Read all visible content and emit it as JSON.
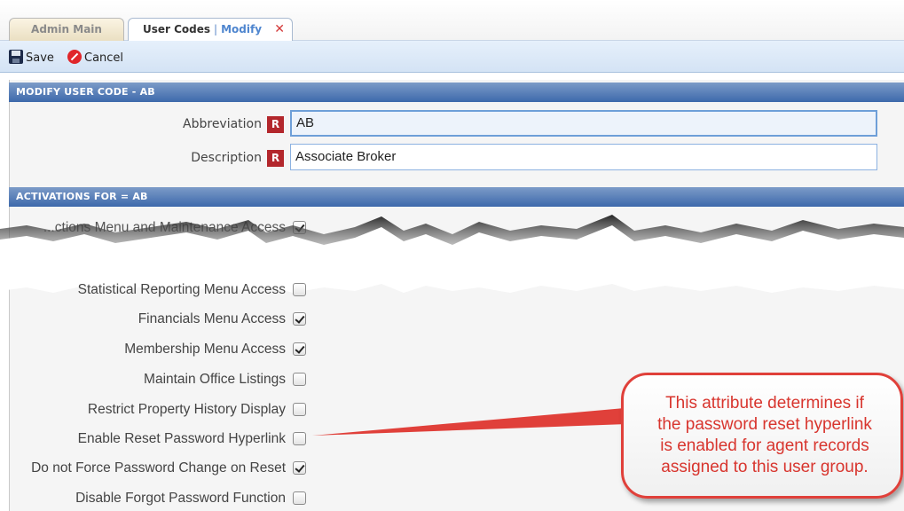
{
  "tabs": [
    {
      "label": "Admin Main"
    },
    {
      "label": "User Codes",
      "sub": "Modify"
    }
  ],
  "toolbar": {
    "save_label": "Save",
    "cancel_label": "Cancel"
  },
  "modify_section": {
    "title": "MODIFY USER CODE - AB",
    "fields": [
      {
        "label": "Abbreviation",
        "required_badge": "R",
        "value": "AB"
      },
      {
        "label": "Description",
        "required_badge": "R",
        "value": "Associate Broker"
      }
    ]
  },
  "activations_section": {
    "title": "ACTIVATIONS FOR = AB",
    "partial_rows": [
      {
        "label": "...ctions Menu and Maintenance Access",
        "checked": true
      },
      {
        "label": "Statistical Reporting Menu Access",
        "checked": false
      }
    ],
    "rows": [
      {
        "label": "Financials Menu Access",
        "checked": true
      },
      {
        "label": "Membership Menu Access",
        "checked": true
      },
      {
        "label": "Maintain Office Listings",
        "checked": false
      },
      {
        "label": "Restrict Property History Display",
        "checked": false
      },
      {
        "label": "Enable Reset Password Hyperlink",
        "checked": false
      },
      {
        "label": "Do not Force Password Change on Reset",
        "checked": true
      },
      {
        "label": "Disable Forgot Password Function",
        "checked": false
      }
    ]
  },
  "callout": {
    "lines": [
      "This attribute determines if",
      "the password reset hyperlink",
      "is enabled for agent records",
      "assigned to this user group."
    ]
  },
  "colors": {
    "header_blue": "#3d69ab",
    "required_red": "#b3272c",
    "callout_red": "#e0403a"
  },
  "icons": {
    "save": "floppy-disk-icon",
    "cancel": "cancel-circle-icon",
    "close_tab": "close-icon"
  }
}
